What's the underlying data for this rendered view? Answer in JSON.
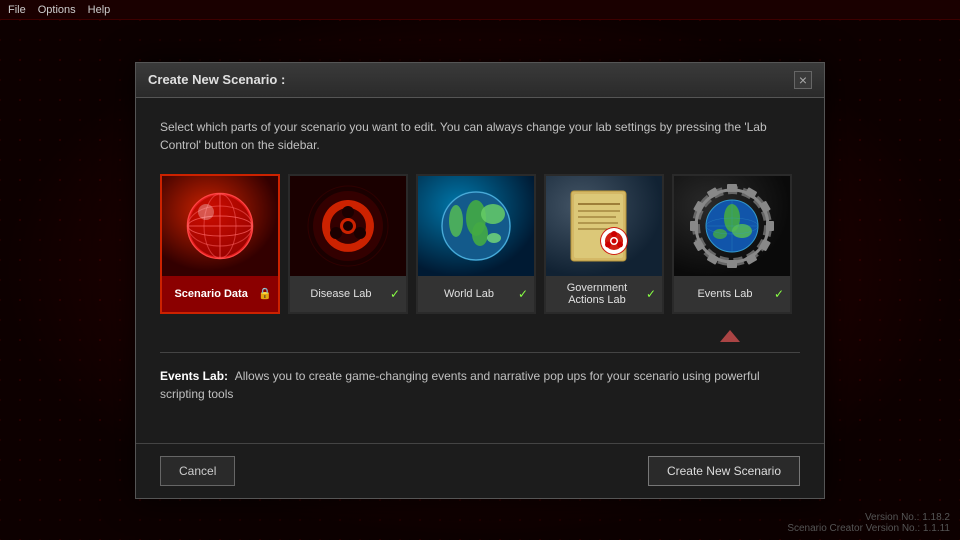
{
  "menubar": {
    "items": [
      "File",
      "Options",
      "Help"
    ]
  },
  "dialog": {
    "title": "Create New Scenario :",
    "close_label": "×",
    "description": "Select which parts of your scenario you want to edit. You can always change your lab settings by pressing the 'Lab Control' button on the sidebar.",
    "cards": [
      {
        "id": "scenario-data",
        "label": "Scenario Data",
        "has_lock": true,
        "has_check": false,
        "selected": true,
        "type": "scenario"
      },
      {
        "id": "disease-lab",
        "label": "Disease Lab",
        "has_lock": false,
        "has_check": true,
        "selected": false,
        "type": "disease"
      },
      {
        "id": "world-lab",
        "label": "World Lab",
        "has_lock": false,
        "has_check": true,
        "selected": false,
        "type": "world"
      },
      {
        "id": "government-actions-lab",
        "label": "Government Actions Lab",
        "has_lock": false,
        "has_check": true,
        "selected": false,
        "type": "gov"
      },
      {
        "id": "events-lab",
        "label": "Events Lab",
        "has_lock": false,
        "has_check": true,
        "selected": false,
        "type": "events"
      }
    ],
    "active_description": {
      "label": "Events Lab:",
      "text": "Allows you to create game-changing events and narrative pop ups for your scenario using powerful scripting tools"
    },
    "footer": {
      "cancel_label": "Cancel",
      "create_label": "Create New Scenario"
    }
  },
  "version": {
    "line1": "Version No.: 1.18.2",
    "line2": "Scenario Creator Version No.: 1.1.11"
  }
}
